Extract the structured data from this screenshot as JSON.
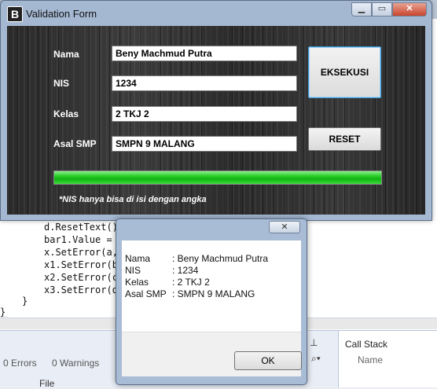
{
  "form": {
    "title": "Validation Form",
    "app_icon_letter": "B",
    "fields": [
      {
        "label": "Nama",
        "value": "Beny Machmud Putra"
      },
      {
        "label": "NIS",
        "value": "1234"
      },
      {
        "label": "Kelas",
        "value": "2 TKJ 2"
      },
      {
        "label": "Asal SMP",
        "value": "SMPN 9 MALANG"
      }
    ],
    "execute_label": "EKSEKUSI",
    "reset_label": "RESET",
    "progress_fraction": 1.0,
    "note": "*NIS hanya bisa di isi dengan angka",
    "progress_color": "#2fd02f"
  },
  "dialog": {
    "lines": [
      {
        "key": "Nama",
        "value": ": Beny Machmud Putra"
      },
      {
        "key": "NIS",
        "value": ": 1234"
      },
      {
        "key": "Kelas",
        "value": ": 2 TKJ 2"
      },
      {
        "key": "Asal SMP",
        "value": ": SMPN 9 MALANG"
      }
    ],
    "ok_label": "OK"
  },
  "ide": {
    "code_lines": [
      "d.ResetText()",
      "bar1.Value =",
      "x.SetError(a,",
      "x1.SetError(b",
      "x2.SetError(c",
      "x3.SetError(d"
    ],
    "closing_brace": "}",
    "errors": "0 Errors",
    "warnings": "0 Warnings",
    "file_col": "File",
    "callstack_title": "Call Stack",
    "callstack_name": "Name"
  }
}
